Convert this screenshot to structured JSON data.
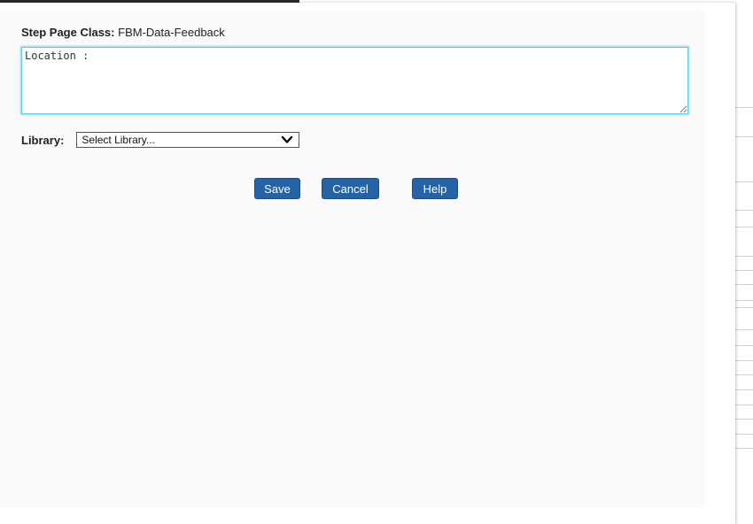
{
  "form": {
    "step_page_class_label": "Step Page Class:",
    "step_page_class_value": "FBM-Data-Feedback",
    "location_text": "Location :",
    "library_label": "Library:",
    "library_selected": "Select Library..."
  },
  "buttons": {
    "save": "Save",
    "cancel": "Cancel",
    "help": "Help"
  },
  "colors": {
    "button_bg": "#2563a6",
    "textarea_focus_border": "#6cc9e4"
  },
  "icons": {
    "select_chevron": "chevron-down-icon"
  }
}
